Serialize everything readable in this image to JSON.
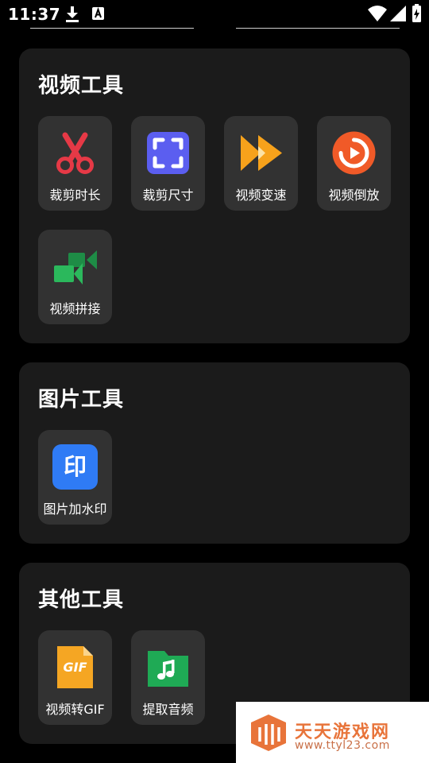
{
  "status_bar": {
    "time": "11:37"
  },
  "sections": [
    {
      "title": "视频工具",
      "tools": [
        {
          "label": "裁剪时长",
          "icon": "scissors-icon"
        },
        {
          "label": "裁剪尺寸",
          "icon": "crop-frame-icon"
        },
        {
          "label": "视频变速",
          "icon": "fast-forward-icon"
        },
        {
          "label": "视频倒放",
          "icon": "reverse-play-icon"
        },
        {
          "label": "视频拼接",
          "icon": "video-merge-icon"
        }
      ]
    },
    {
      "title": "图片工具",
      "tools": [
        {
          "label": "图片加水印",
          "icon": "stamp-icon",
          "glyph": "印"
        }
      ]
    },
    {
      "title": "其他工具",
      "tools": [
        {
          "label": "视频转GIF",
          "icon": "gif-file-icon",
          "glyph": "GIF"
        },
        {
          "label": "提取音频",
          "icon": "music-folder-icon"
        }
      ]
    }
  ],
  "watermark": {
    "title": "天天游戏网",
    "url": "www.ttyl23.com"
  },
  "colors": {
    "background": "#000000",
    "card": "#1b1b1b",
    "tile": "#323232",
    "scissors": "#e63946",
    "crop": "#5b5ef0",
    "speed": "#f7a21b",
    "reverse": "#f05a28",
    "merge": "#2bb85c",
    "stamp": "#2f7bf5",
    "gif": "#f5a623",
    "audio": "#1faa55",
    "watermark": "#e8743a"
  }
}
